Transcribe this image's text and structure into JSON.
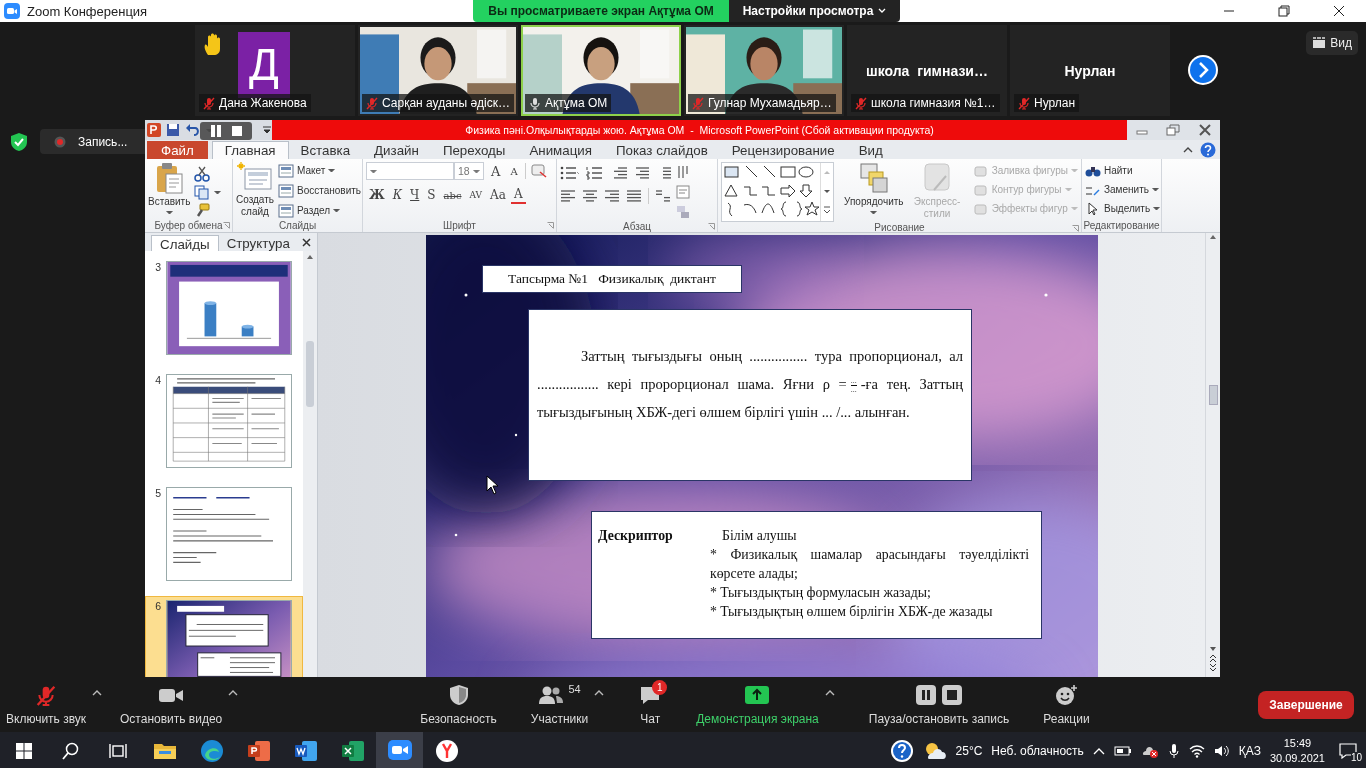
{
  "window": {
    "title": "Zoom Конференция"
  },
  "share_banner": {
    "text": "Вы просматриваете экран Ақтұма ОМ",
    "view_options": "Настройки просмотра"
  },
  "participants": [
    {
      "kind": "avatar",
      "initial": "Д",
      "name": "Дана Жакенова",
      "muted": true,
      "hand_raised": true,
      "active_speaker": false
    },
    {
      "kind": "video",
      "name": "Сарқан ауданы әдіск…",
      "muted": true,
      "hand_raised": false,
      "active_speaker": false
    },
    {
      "kind": "video",
      "name": "Ақтұма ОМ",
      "muted": false,
      "hand_raised": false,
      "active_speaker": true
    },
    {
      "kind": "video",
      "name": "Гулнар Мухамадьяр…",
      "muted": true,
      "hand_raised": false,
      "active_speaker": false
    },
    {
      "kind": "name",
      "title": "школа  гимнази…",
      "name": "школа гимназия №1…",
      "muted": true,
      "hand_raised": false,
      "active_speaker": false
    },
    {
      "kind": "name",
      "title": "Нурлан",
      "name": "Нурлан",
      "muted": true,
      "hand_raised": false,
      "active_speaker": false
    }
  ],
  "view_button": "Вид",
  "recording": {
    "label": "Запись..."
  },
  "powerpoint": {
    "title": "Физика пәні.Олқылықтарды жою. Ақтұма ОМ  -  Microsoft PowerPoint (Сбой активации продукта)",
    "tabs": [
      {
        "label": "Файл",
        "kind": "file",
        "selected": false
      },
      {
        "label": "Главная",
        "kind": "tab",
        "selected": true
      },
      {
        "label": "Вставка",
        "kind": "tab",
        "selected": false
      },
      {
        "label": "Дизайн",
        "kind": "tab",
        "selected": false
      },
      {
        "label": "Переходы",
        "kind": "tab",
        "selected": false
      },
      {
        "label": "Анимация",
        "kind": "tab",
        "selected": false
      },
      {
        "label": "Показ слайдов",
        "kind": "tab",
        "selected": false
      },
      {
        "label": "Рецензирование",
        "kind": "tab",
        "selected": false
      },
      {
        "label": "Вид",
        "kind": "tab",
        "selected": false
      }
    ],
    "ribbon": [
      {
        "kind": "clipboard",
        "label": "Буфер обмена",
        "paste": "Вставить"
      },
      {
        "kind": "slides",
        "label": "Слайды",
        "new_slide": "Создать слайд",
        "items": [
          "Макет",
          "Восстановить",
          "Раздел"
        ]
      },
      {
        "kind": "font",
        "label": "Шрифт",
        "size": "18",
        "grow": "A",
        "shrink": "A",
        "buttons": [
          "Ж",
          "К",
          "Ч",
          "S",
          "abc",
          "AV",
          "Aa",
          "A"
        ]
      },
      {
        "kind": "paragraph",
        "label": "Абзац"
      },
      {
        "kind": "drawing",
        "label": "Рисование",
        "arrange": "Упорядочить",
        "styles": "Экспресс-стили",
        "styles_disabled": true,
        "items": [
          {
            "label": "Заливка фигуры",
            "disabled": true
          },
          {
            "label": "Контур фигуры",
            "disabled": true
          },
          {
            "label": "Эффекты фигур",
            "disabled": true
          }
        ]
      },
      {
        "kind": "editing",
        "label": "Редактирование",
        "items": [
          "Найти",
          "Заменить",
          "Выделить"
        ]
      }
    ],
    "panel_tabs": [
      {
        "label": "Слайды",
        "selected": true
      },
      {
        "label": "Структура",
        "selected": false
      }
    ],
    "thumbnails": [
      {
        "number": "3",
        "kind": "chart",
        "selected": false
      },
      {
        "number": "4",
        "kind": "table",
        "selected": false
      },
      {
        "number": "5",
        "kind": "text",
        "selected": false
      },
      {
        "number": "6",
        "kind": "galaxy",
        "selected": true
      }
    ],
    "slide": {
      "title": "Тапсырма №1   Физикалық  диктант",
      "paragraph_start": "Заттың тығыздығы оның ................ тура пропорционал, ал ................. кері пророрционал шама. Яғни ρ =",
      "fraction": {
        "numerator": "...",
        "denominator": "..."
      },
      "paragraph_end": "-ға тең. Заттың тығыздығының ХБЖ-дегі өлшем бірлігі үшін  ... /... алынған.",
      "descriptor": {
        "heading": "Дескриптор",
        "lines": [
          "Білім алушы",
          "*  Физикалық  шамалар арасындағы тәуелділікті көрсете алады;",
          "* Тығыздықтың формуласын жазады;",
          "* Тығыздықтың өлшем бірлігін ХБЖ-де жазады"
        ]
      }
    }
  },
  "toolbar": [
    {
      "kind": "mic",
      "label": "Включить звук",
      "caret": true,
      "selected": false
    },
    {
      "kind": "video",
      "label": "Остановить видео",
      "caret": true,
      "selected": false
    },
    {
      "kind": "security",
      "label": "Безопасность",
      "caret": false,
      "selected": false
    },
    {
      "kind": "participants",
      "label": "Участники",
      "count": "54",
      "caret": true,
      "selected": false
    },
    {
      "kind": "chat",
      "label": "Чат",
      "badge": "1",
      "caret": false,
      "selected": false
    },
    {
      "kind": "share",
      "label": "Демонстрация экрана",
      "caret": true,
      "selected": true
    },
    {
      "kind": "record",
      "label": "Пауза/остановить запись",
      "caret": false,
      "selected": false
    },
    {
      "kind": "reactions",
      "label": "Реакции",
      "caret": false,
      "selected": false
    }
  ],
  "end_button": "Завершение",
  "taskbar": {
    "apps": [
      {
        "kind": "explorer",
        "selected": false
      },
      {
        "kind": "edge",
        "selected": false
      },
      {
        "kind": "powerpoint",
        "selected": false
      },
      {
        "kind": "word",
        "selected": false
      },
      {
        "kind": "excel",
        "selected": false
      },
      {
        "kind": "zoom",
        "selected": true
      },
      {
        "kind": "yandex",
        "selected": false
      }
    ],
    "temperature": "25°C",
    "weather": "Неб. облачность",
    "language": "ҚАЗ",
    "time": "15:49",
    "date": "30.09.2021",
    "notifications": "10"
  }
}
